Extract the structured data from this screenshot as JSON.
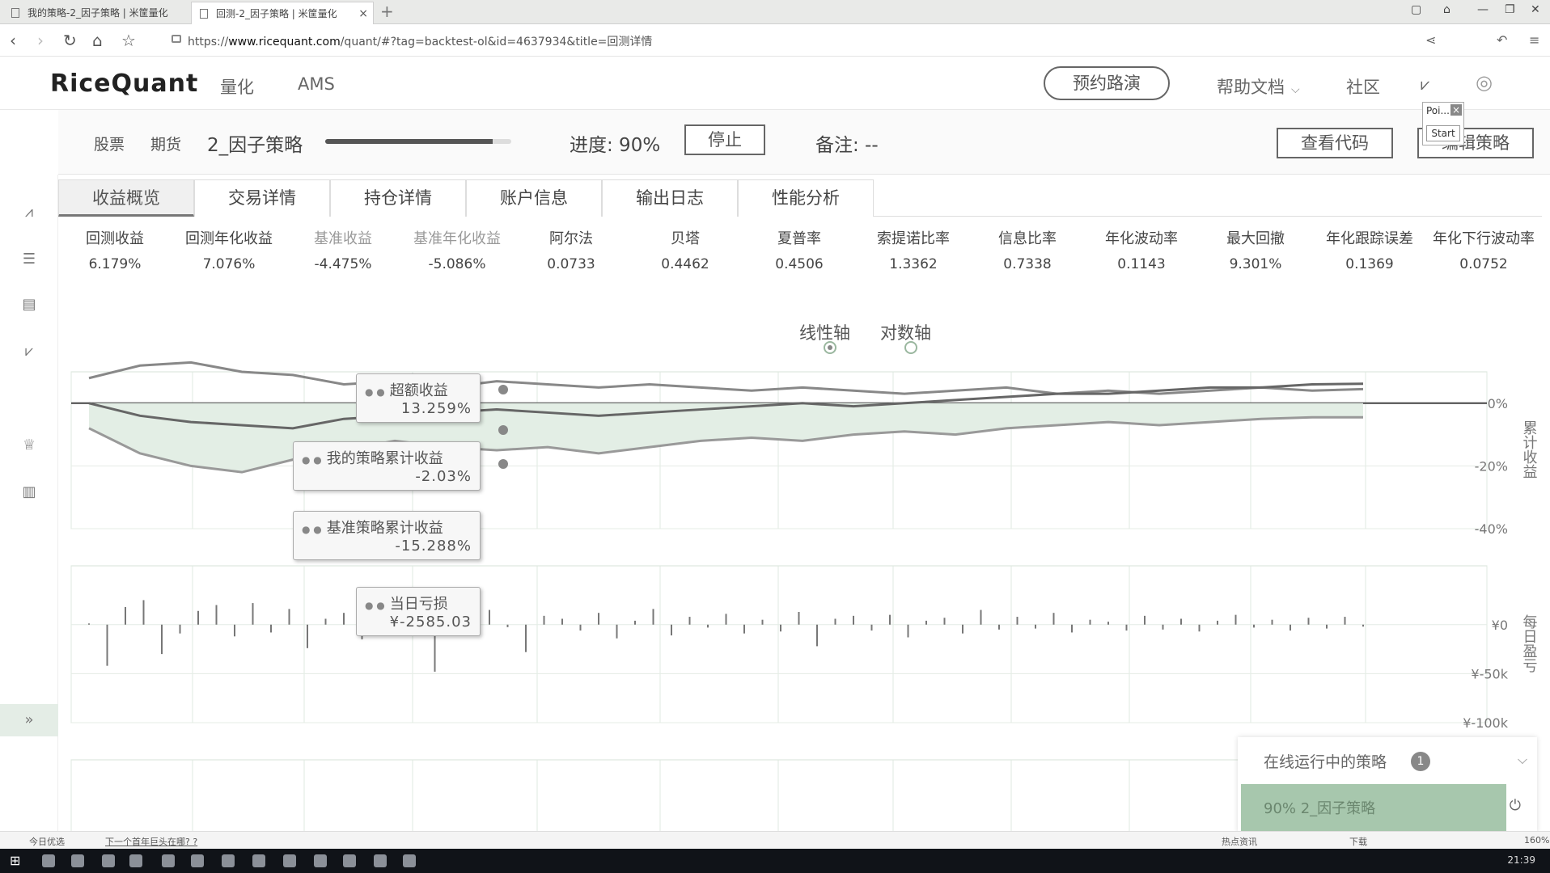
{
  "browser": {
    "tabs": [
      {
        "title": "我的策略-2_因子策略 | 米筐量化"
      },
      {
        "title": "回测-2_因子策略 | 米筐量化"
      }
    ],
    "url_prefix": "https://",
    "url_host": "www.ricequant.com",
    "url_path": "/quant/#?tag=backtest-ol&id=4637934&title=回测详情"
  },
  "header": {
    "logo": "RiceQuant",
    "nav": [
      "量化",
      "AMS"
    ],
    "roadshow": "预约路演",
    "help": "帮助文档",
    "community": "社区"
  },
  "strategy": {
    "tags": [
      "股票",
      "期货"
    ],
    "name": "2_因子策略",
    "progress_label": "进度: 90%",
    "progress": 0.9,
    "stop": "停止",
    "note": "备注: --",
    "view_code": "查看代码",
    "edit": "编辑策略"
  },
  "popup": {
    "title": "Poi...",
    "close": "×",
    "start": "Start"
  },
  "tabs": [
    "收益概览",
    "交易详情",
    "持仓详情",
    "账户信息",
    "输出日志",
    "性能分析"
  ],
  "metrics": [
    {
      "label": "回测收益",
      "value": "6.179%",
      "muted": false
    },
    {
      "label": "回测年化收益",
      "value": "7.076%",
      "muted": false
    },
    {
      "label": "基准收益",
      "value": "-4.475%",
      "muted": true
    },
    {
      "label": "基准年化收益",
      "value": "-5.086%",
      "muted": true
    },
    {
      "label": "阿尔法",
      "value": "0.0733",
      "muted": false
    },
    {
      "label": "贝塔",
      "value": "0.4462",
      "muted": false
    },
    {
      "label": "夏普率",
      "value": "0.4506",
      "muted": false
    },
    {
      "label": "索提诺比率",
      "value": "1.3362",
      "muted": false
    },
    {
      "label": "信息比率",
      "value": "0.7338",
      "muted": false
    },
    {
      "label": "年化波动率",
      "value": "0.1143",
      "muted": false
    },
    {
      "label": "最大回撤",
      "value": "9.301%",
      "muted": false
    },
    {
      "label": "年化跟踪误差",
      "value": "0.1369",
      "muted": false
    },
    {
      "label": "年化下行波动率",
      "value": "0.0752",
      "muted": false
    }
  ],
  "axis_toggle": {
    "linear": "线性轴",
    "log": "对数轴",
    "selected": "linear"
  },
  "chart_data": [
    {
      "type": "line",
      "ylabel": "累计收益",
      "yticks": [
        "0%",
        "-20%",
        "-40%"
      ],
      "ylim": [
        -40,
        10
      ],
      "series": [
        {
          "name": "超额收益",
          "values": [
            8,
            12,
            13,
            10,
            9,
            6,
            7,
            5,
            7,
            6,
            5,
            6,
            5,
            4,
            5,
            4,
            3,
            4,
            5,
            3,
            4,
            3,
            4,
            5,
            4,
            4.5
          ]
        },
        {
          "name": "我的策略累计收益",
          "values": [
            0,
            -4,
            -6,
            -7,
            -8,
            -5,
            -4,
            -3,
            -2,
            -3,
            -4,
            -3,
            -2,
            -1,
            0,
            -1,
            0,
            1,
            2,
            3,
            3,
            4,
            5,
            5,
            6,
            6.2
          ]
        },
        {
          "name": "基准策略累计收益",
          "values": [
            -8,
            -16,
            -20,
            -22,
            -18,
            -15,
            -12,
            -14,
            -15,
            -14,
            -16,
            -14,
            -12,
            -11,
            -12,
            -10,
            -9,
            -10,
            -8,
            -7,
            -6,
            -7,
            -6,
            -5,
            -4.5,
            -4.5
          ]
        }
      ],
      "tooltips": [
        {
          "name": "超额收益",
          "value": "13.259%"
        },
        {
          "name": "我的策略累计收益",
          "value": "-2.03%"
        },
        {
          "name": "基准策略累计收益",
          "value": "-15.288%"
        }
      ]
    },
    {
      "type": "bar",
      "ylabel": "每日盈亏",
      "yticks": [
        "¥0",
        "¥-50k",
        "¥-100k"
      ],
      "ylim": [
        -100000,
        60000
      ],
      "values": [
        1200,
        -42000,
        18000,
        25000,
        -30000,
        -9000,
        14000,
        20000,
        -12000,
        22000,
        -8000,
        16000,
        -24000,
        6000,
        12000,
        -15000,
        9000,
        -5000,
        18000,
        -48000,
        10000,
        -3000,
        15000,
        -2585,
        -28000,
        9000,
        6000,
        -6000,
        12000,
        -14000,
        4000,
        16000,
        -11000,
        8000,
        -3000,
        11000,
        -9000,
        5000,
        -7000,
        13000,
        -22000,
        6000,
        9000,
        -6000,
        10000,
        -13000,
        4000,
        7000,
        -9000,
        15000,
        -5000,
        8000,
        -4000,
        12000,
        -8000,
        5000,
        3000,
        -6000,
        9000,
        -5000,
        6000,
        -7000,
        4000,
        10000,
        -3000,
        5000,
        -6000,
        7000,
        -4000,
        8000,
        -2000
      ]
    }
  ],
  "tooltip_daily": {
    "name": "当日亏损",
    "value": "¥-2585.03"
  },
  "running": {
    "title": "在线运行中的策略",
    "count": "1",
    "item": "90% 2_因子策略"
  },
  "statusbar": {
    "left": "今日优选",
    "link": "下一个首年巨头在哪? ?",
    "right_a": "热点资讯",
    "right_b": "下载",
    "zoom": "160%"
  },
  "clock": "21:39"
}
